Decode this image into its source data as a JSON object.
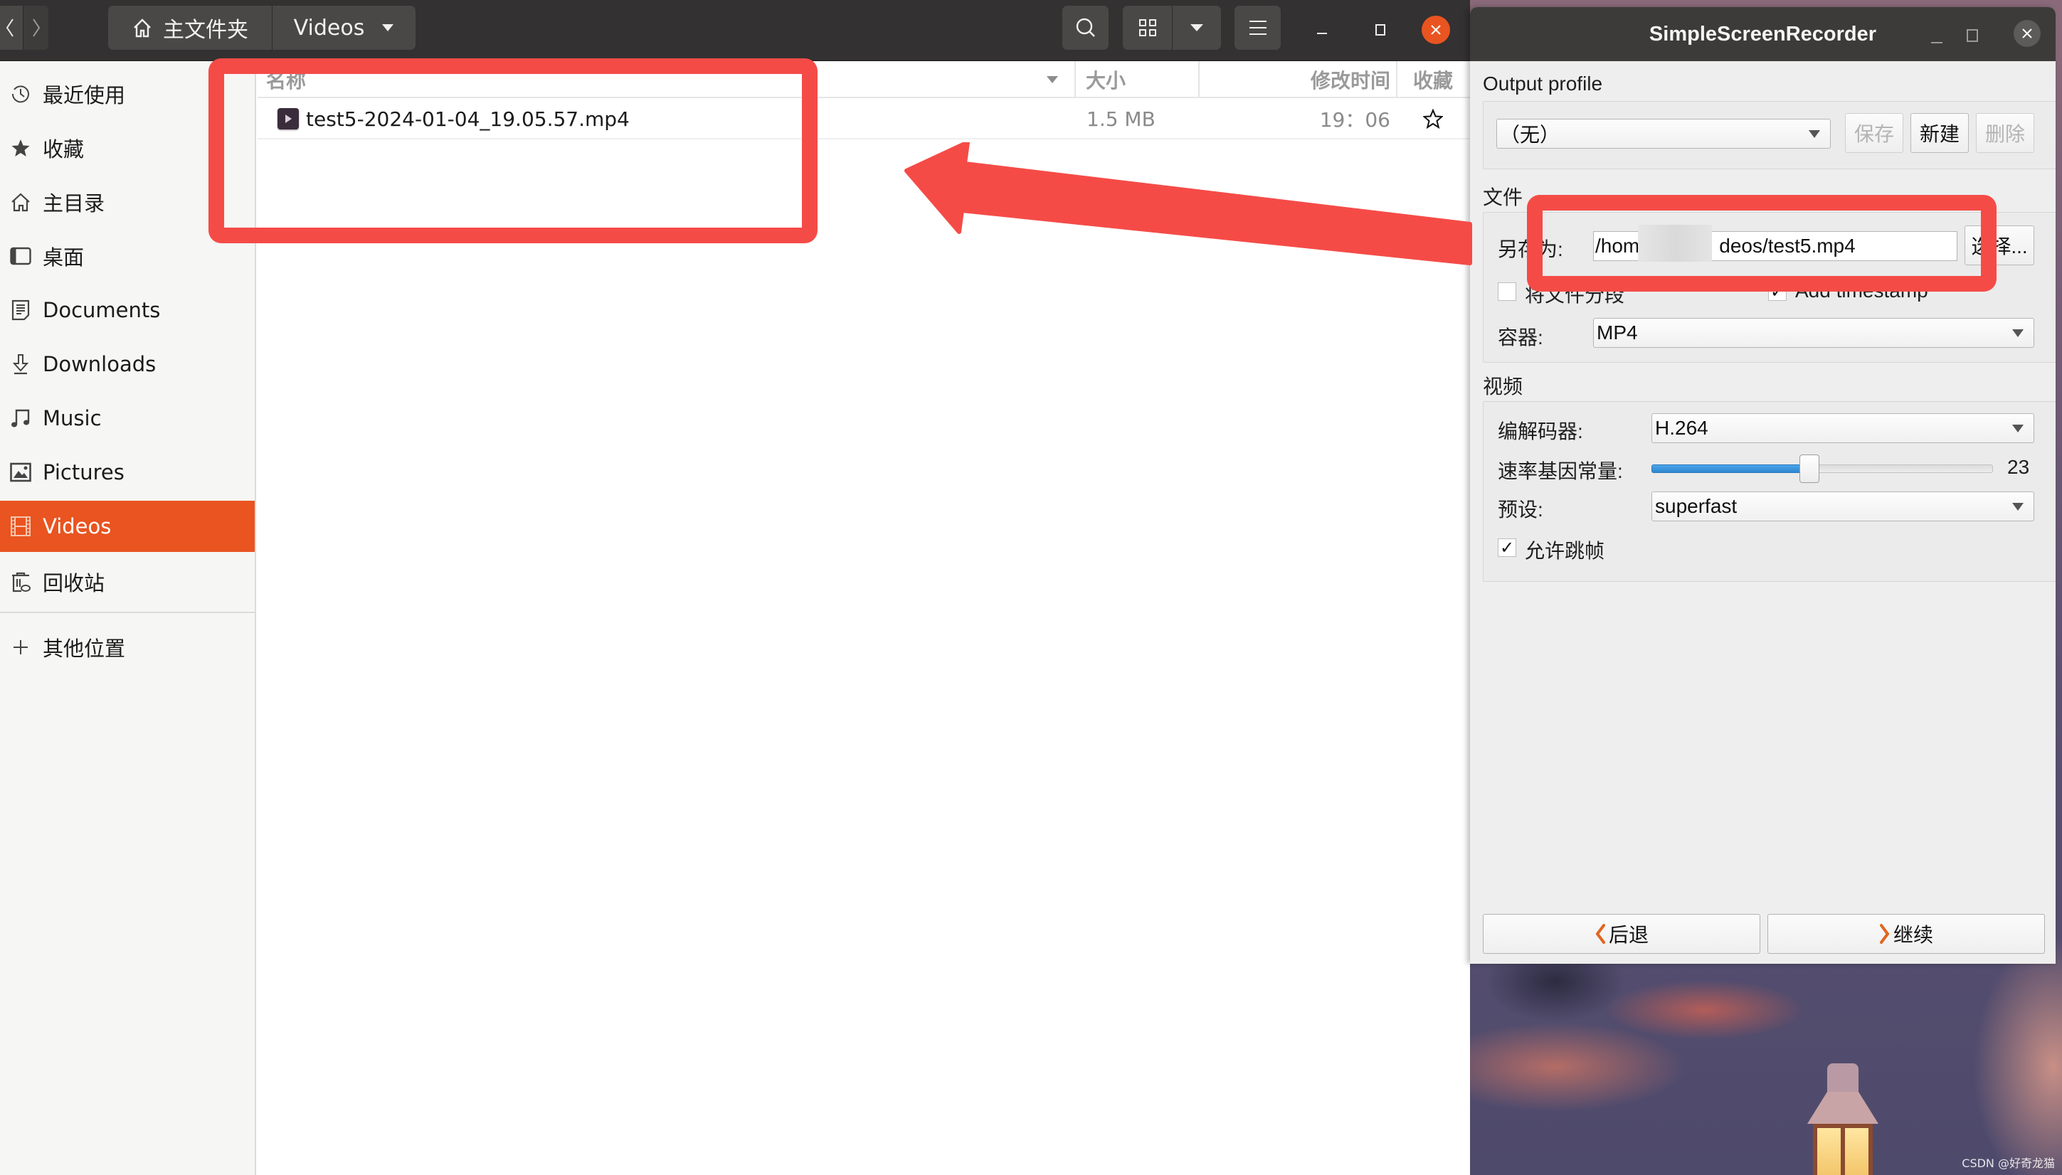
{
  "file_manager": {
    "nav": {
      "back_icon": "chevron-left-icon",
      "forward_icon": "chevron-right-icon"
    },
    "pathbar": {
      "home_label": "主文件夹",
      "current_label": "Videos"
    },
    "toolbar": {
      "search_icon": "search-icon",
      "view_icon": "grid-view-icon",
      "view_menu_icon": "triangle-down-icon",
      "menu_icon": "hamburger-menu-icon"
    },
    "window_controls": {
      "minimize": "minimize-icon",
      "maximize": "maximize-icon",
      "close": "close-icon"
    },
    "sidebar": {
      "items": [
        {
          "label": "最近使用",
          "icon": "clock-icon"
        },
        {
          "label": "收藏",
          "icon": "star-icon"
        },
        {
          "label": "主目录",
          "icon": "home-icon"
        },
        {
          "label": "桌面",
          "icon": "desktop-icon"
        },
        {
          "label": "Documents",
          "icon": "document-icon"
        },
        {
          "label": "Downloads",
          "icon": "download-icon"
        },
        {
          "label": "Music",
          "icon": "music-icon"
        },
        {
          "label": "Pictures",
          "icon": "picture-icon"
        },
        {
          "label": "Videos",
          "icon": "film-icon",
          "active": true
        },
        {
          "label": "回收站",
          "icon": "trash-icon"
        }
      ],
      "other_locations": {
        "label": "其他位置",
        "icon": "plus-icon"
      }
    },
    "columns": {
      "name": "名称",
      "size": "大小",
      "modified": "修改时间",
      "starred": "收藏"
    },
    "files": [
      {
        "name": "test5-2024-01-04_19.05.57.mp4",
        "size": "1.5 MB",
        "modified": "19：06",
        "starred": false
      }
    ]
  },
  "ssr": {
    "title": "SimpleScreenRecorder",
    "output_profile": {
      "section_title": "Output profile",
      "selected": "（无）",
      "save_label": "保存",
      "new_label": "新建",
      "delete_label": "删除"
    },
    "file": {
      "section_title": "文件",
      "save_as_label": "另存为:",
      "path_start": "/hom",
      "path_end": "deos/test5.mp4",
      "browse_label": "选择...",
      "split_label": "将文件分段",
      "split_checked": false,
      "timestamp_label": "Add timestamp",
      "timestamp_checked": true,
      "container_label": "容器:",
      "container_value": "MP4"
    },
    "video": {
      "section_title": "视频",
      "codec_label": "编解码器:",
      "codec_value": "H.264",
      "crf_label": "速率基因常量:",
      "crf_value": "23",
      "crf_fraction": 0.46,
      "preset_label": "预设:",
      "preset_value": "superfast",
      "allow_skip_label": "允许跳帧",
      "allow_skip_checked": true
    },
    "nav": {
      "back_label": "后退",
      "continue_label": "继续"
    }
  },
  "watermark": "CSDN @好奇龙猫",
  "colors": {
    "accent": "#e95420",
    "annotation": "#f54b47",
    "header": "#333131",
    "slider_fill": "#2f86d1"
  }
}
